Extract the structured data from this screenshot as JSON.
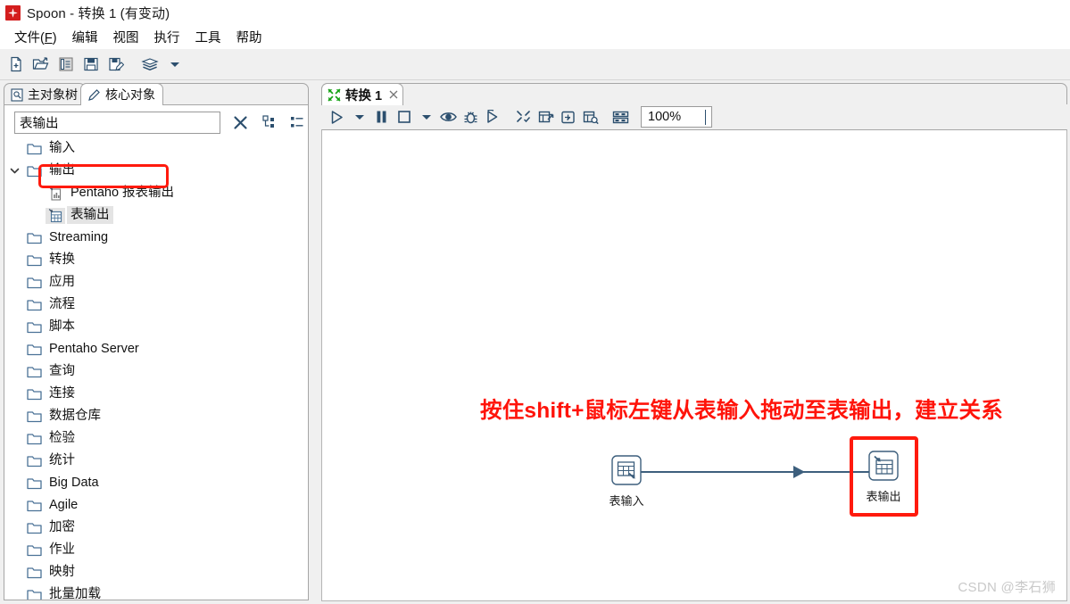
{
  "window": {
    "title": "Spoon - 转换 1 (有变动)",
    "icon": "spoon-app-icon"
  },
  "menubar": {
    "items": [
      {
        "label": "文件(F)",
        "mnemonic": "F"
      },
      {
        "label": "编辑"
      },
      {
        "label": "视图"
      },
      {
        "label": "执行"
      },
      {
        "label": "工具"
      },
      {
        "label": "帮助"
      }
    ]
  },
  "main_toolbar": {
    "buttons": [
      {
        "name": "new-file-icon",
        "title": "新建"
      },
      {
        "name": "open-file-icon",
        "title": "打开"
      },
      {
        "name": "explore-repository-icon",
        "title": "浏览"
      },
      {
        "name": "save-icon",
        "title": "保存"
      },
      {
        "name": "save-as-icon",
        "title": "另存为"
      },
      {
        "name": "layers-icon",
        "title": "图层"
      },
      {
        "name": "chevron-down-icon",
        "title": "更多"
      }
    ]
  },
  "left_panel": {
    "tabs": [
      {
        "label": "主对象树",
        "icon": "document-tree-icon",
        "active": false
      },
      {
        "label": "核心对象",
        "icon": "pencil-icon",
        "active": true
      }
    ],
    "search": {
      "value": "表输出",
      "placeholder": "",
      "clear_icon": "close-icon",
      "tools": [
        {
          "name": "expand-all-icon"
        },
        {
          "name": "collapse-all-icon"
        }
      ]
    },
    "tree": [
      {
        "label": "输入",
        "level": 0,
        "icon": "folder-icon",
        "expanded": null,
        "selected": false
      },
      {
        "label": "输出",
        "level": 0,
        "icon": "folder-icon",
        "expanded": true,
        "selected": false
      },
      {
        "label": "Pentaho 报表输出",
        "level": 1,
        "icon": "report-output-icon",
        "expanded": null,
        "selected": false
      },
      {
        "label": "表输出",
        "level": 1,
        "icon": "table-output-icon",
        "expanded": null,
        "selected": true
      },
      {
        "label": "Streaming",
        "level": 0,
        "icon": "folder-icon",
        "expanded": null,
        "selected": false
      },
      {
        "label": "转换",
        "level": 0,
        "icon": "folder-icon",
        "expanded": null,
        "selected": false
      },
      {
        "label": "应用",
        "level": 0,
        "icon": "folder-icon",
        "expanded": null,
        "selected": false
      },
      {
        "label": "流程",
        "level": 0,
        "icon": "folder-icon",
        "expanded": null,
        "selected": false
      },
      {
        "label": "脚本",
        "level": 0,
        "icon": "folder-icon",
        "expanded": null,
        "selected": false
      },
      {
        "label": "Pentaho Server",
        "level": 0,
        "icon": "folder-icon",
        "expanded": null,
        "selected": false
      },
      {
        "label": "查询",
        "level": 0,
        "icon": "folder-icon",
        "expanded": null,
        "selected": false
      },
      {
        "label": "连接",
        "level": 0,
        "icon": "folder-icon",
        "expanded": null,
        "selected": false
      },
      {
        "label": "数据仓库",
        "level": 0,
        "icon": "folder-icon",
        "expanded": null,
        "selected": false
      },
      {
        "label": "检验",
        "level": 0,
        "icon": "folder-icon",
        "expanded": null,
        "selected": false
      },
      {
        "label": "统计",
        "level": 0,
        "icon": "folder-icon",
        "expanded": null,
        "selected": false
      },
      {
        "label": "Big Data",
        "level": 0,
        "icon": "folder-icon",
        "expanded": null,
        "selected": false
      },
      {
        "label": "Agile",
        "level": 0,
        "icon": "folder-icon",
        "expanded": null,
        "selected": false
      },
      {
        "label": "加密",
        "level": 0,
        "icon": "folder-icon",
        "expanded": null,
        "selected": false
      },
      {
        "label": "作业",
        "level": 0,
        "icon": "folder-icon",
        "expanded": null,
        "selected": false
      },
      {
        "label": "映射",
        "level": 0,
        "icon": "folder-icon",
        "expanded": null,
        "selected": false
      },
      {
        "label": "批量加载",
        "level": 0,
        "icon": "folder-icon",
        "expanded": null,
        "selected": false
      }
    ]
  },
  "right_panel": {
    "tab": {
      "label": "转换 1",
      "icon": "transformation-icon",
      "close_icon": "close-icon"
    },
    "toolbar": {
      "buttons": [
        {
          "name": "run-icon",
          "title": "运行"
        },
        {
          "name": "run-dropdown-icon",
          "title": "运行选项"
        },
        {
          "name": "pause-icon",
          "title": "暂停"
        },
        {
          "name": "stop-icon",
          "title": "停止"
        },
        {
          "name": "stop-dropdown-icon",
          "title": "停止选项"
        },
        {
          "name": "preview-icon",
          "title": "预览"
        },
        {
          "name": "debug-icon",
          "title": "调试"
        },
        {
          "name": "replay-icon",
          "title": "重放"
        },
        {
          "name": "transformation-settings-icon",
          "title": "转换设置"
        },
        {
          "name": "show-last-impact-icon",
          "title": "显示上次结果"
        },
        {
          "name": "show-execution-results-icon",
          "title": "执行结果"
        },
        {
          "name": "sql-preview-icon",
          "title": "SQL 预览"
        },
        {
          "name": "grid-layout-icon",
          "title": "网格"
        }
      ],
      "zoom": {
        "value": "100%",
        "chevron_icon": "chevron-down-icon"
      }
    },
    "canvas": {
      "annotation": "按住shift+鼠标左键从表输入拖动至表输出，建立关系",
      "annotation_color": "#ff140a",
      "highlight_color": "#ff1a0d",
      "hop_color": "#3d5f7d",
      "steps": [
        {
          "label": "表输入",
          "icon": "table-input-icon",
          "highlighted": false
        },
        {
          "label": "表输出",
          "icon": "table-output-icon",
          "highlighted": true
        }
      ],
      "hop": {
        "from": "表输入",
        "to": "表输出",
        "arrow_icon": "arrow-right-icon"
      }
    }
  },
  "watermark": {
    "text": "CSDN @李石狮"
  }
}
